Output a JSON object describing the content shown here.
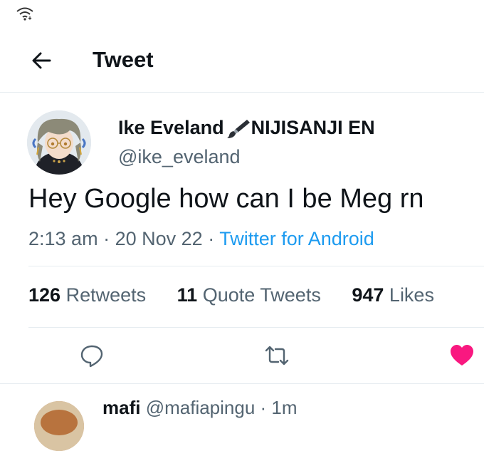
{
  "header": {
    "title": "Tweet"
  },
  "tweet": {
    "author_name": "Ike Eveland",
    "author_suffix": "NIJISANJI EN",
    "author_handle": "@ike_eveland",
    "text": "Hey Google how can I be Meg rn",
    "time": "2:13 am",
    "date": "20 Nov 22",
    "source": "Twitter for Android",
    "separator": "·",
    "stats": {
      "retweets_count": "126",
      "retweets_label": "Retweets",
      "quote_count": "11",
      "quote_label": "Quote Tweets",
      "likes_count": "947",
      "likes_label": "Likes"
    },
    "liked": true
  },
  "next_reply": {
    "name": "mafi",
    "handle": "@mafiapingu",
    "time": "· 1m"
  },
  "colors": {
    "accent": "#1d9bf0",
    "like": "#f91880",
    "secondary_text": "#536471",
    "divider": "#e6ecf0"
  },
  "icons": [
    "wifi-icon",
    "back-arrow-icon",
    "brush-icon",
    "reply-icon",
    "retweet-icon",
    "like-heart-icon"
  ]
}
